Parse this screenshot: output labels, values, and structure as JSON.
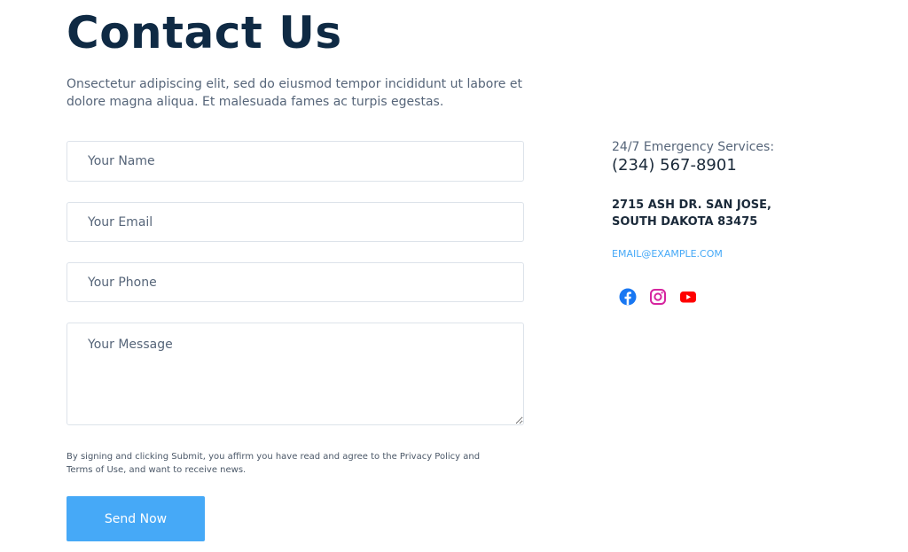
{
  "contact": {
    "title": "Contact Us",
    "intro": "Onsectetur adipiscing elit, sed do eiusmod tempor incididunt ut labore et dolore magna aliqua. Et malesuada fames ac turpis egestas."
  },
  "form": {
    "name_placeholder": "Your Name",
    "email_placeholder": "Your Email",
    "phone_placeholder": "Your Phone",
    "message_placeholder": "Your Message",
    "legal_text": "By signing and clicking Submit, you affirm you have read and agree to the Privacy Policy and Terms of Use, and want to receive news.",
    "submit_label": "Send Now"
  },
  "info": {
    "emergency_label": "24/7 Emergency Services:",
    "phone": "(234) 567-8901",
    "address": "2715 ASH DR. SAN JOSE, SOUTH DAKOTA 83475",
    "email": "EMAIL@EXAMPLE.COM"
  },
  "social": {
    "icons": [
      "facebook-icon",
      "instagram-icon",
      "youtube-icon"
    ]
  },
  "colors": {
    "heading": "#0f2a44",
    "accent": "#46a9f7",
    "facebook": "#1877f2",
    "instagram": "#d6249f",
    "youtube": "#ff0000"
  }
}
